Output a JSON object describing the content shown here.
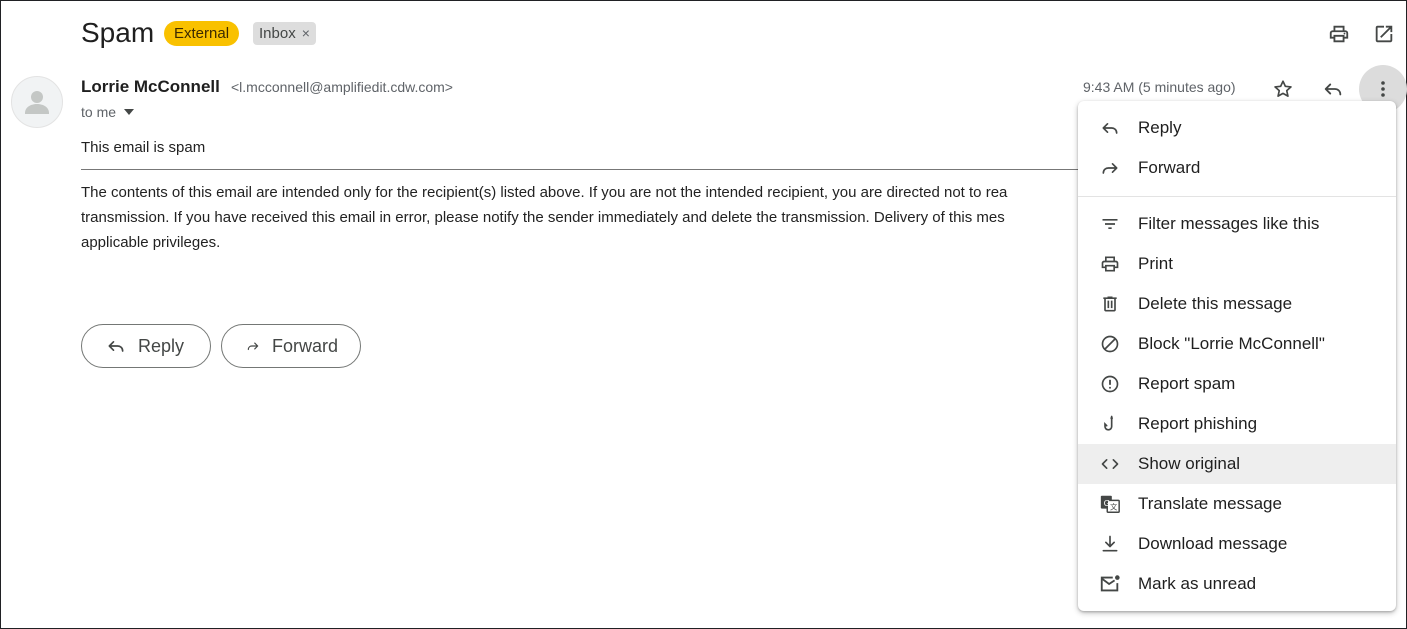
{
  "email": {
    "subject": "Spam",
    "labels": {
      "external": "External",
      "inbox": "Inbox",
      "inbox_remove": "×"
    },
    "sender_name": "Lorrie McConnell",
    "sender_email": "<l.mcconnell@amplifiedit.cdw.com>",
    "recipient": "to me",
    "timestamp": "9:43 AM (5 minutes ago)",
    "body_line": "This email is spam",
    "disclaimer": [
      "The contents of this email are intended only for the recipient(s) listed above. If you are not the intended recipient, you are directed not to rea",
      "transmission. If you have received this email in error, please notify the sender immediately and delete the transmission. Delivery of this mes",
      "applicable privileges."
    ]
  },
  "buttons": {
    "reply": "Reply",
    "forward": "Forward"
  },
  "menu": {
    "items": [
      {
        "label": "Reply",
        "icon": "reply-icon"
      },
      {
        "label": "Forward",
        "icon": "forward-icon"
      },
      {
        "label": "Filter messages like this",
        "icon": "filter-icon"
      },
      {
        "label": "Print",
        "icon": "print-icon"
      },
      {
        "label": "Delete this message",
        "icon": "trash-icon"
      },
      {
        "label": "Block \"Lorrie McConnell\"",
        "icon": "block-icon"
      },
      {
        "label": "Report spam",
        "icon": "report-spam-icon"
      },
      {
        "label": "Report phishing",
        "icon": "phishing-hook-icon"
      },
      {
        "label": "Show original",
        "icon": "code-icon",
        "highlighted": true
      },
      {
        "label": "Translate message",
        "icon": "translate-icon"
      },
      {
        "label": "Download message",
        "icon": "download-icon"
      },
      {
        "label": "Mark as unread",
        "icon": "mark-unread-icon"
      }
    ]
  },
  "colors": {
    "external_badge": "#f9c100",
    "inbox_badge": "#dddddd",
    "menu_highlight": "#eeeeee"
  }
}
